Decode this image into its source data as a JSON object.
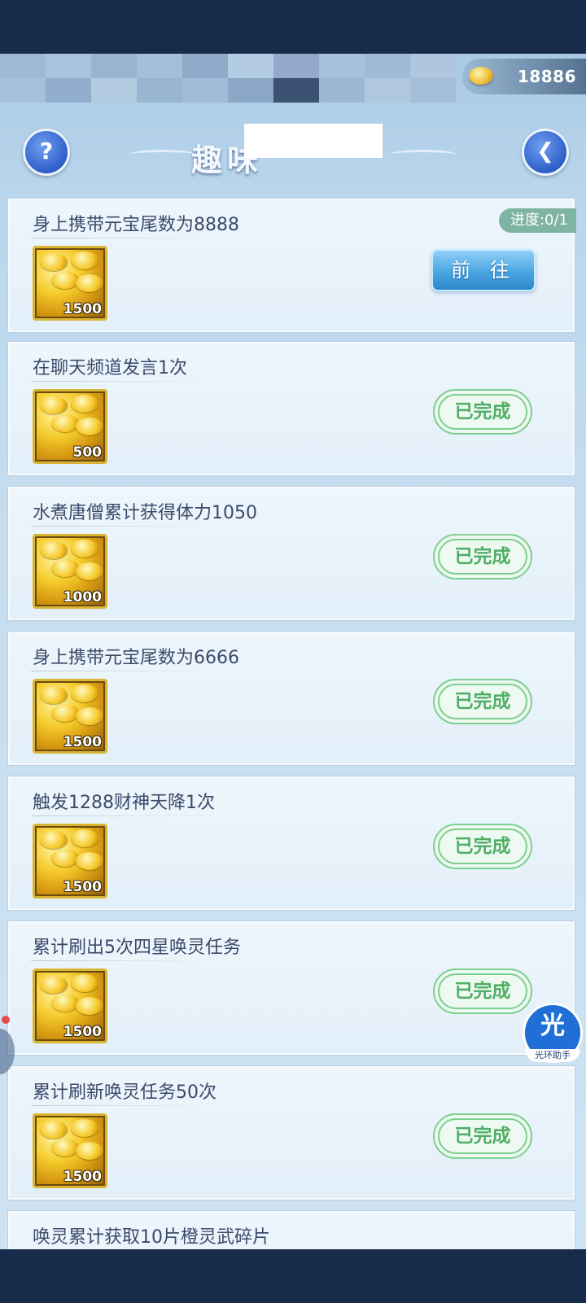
{
  "header": {
    "coin_value": "18886",
    "title": "趣味"
  },
  "tasks": [
    {
      "title": "身上携带元宝尾数为8888",
      "reward": "1500",
      "progress": "进度:0/1",
      "action": "前 往",
      "status": "go"
    },
    {
      "title": "在聊天频道发言1次",
      "reward": "500",
      "action": "已完成",
      "status": "done"
    },
    {
      "title": "水煮唐僧累计获得体力1050",
      "reward": "1000",
      "action": "已完成",
      "status": "done"
    },
    {
      "title": "身上携带元宝尾数为6666",
      "reward": "1500",
      "action": "已完成",
      "status": "done"
    },
    {
      "title": "触发1288财神天降1次",
      "reward": "1500",
      "action": "已完成",
      "status": "done"
    },
    {
      "title": "累计刷出5次四星唤灵任务",
      "reward": "1500",
      "action": "已完成",
      "status": "done"
    },
    {
      "title": "累计刷新唤灵任务50次",
      "reward": "1500",
      "action": "已完成",
      "status": "done"
    },
    {
      "title": "唤灵累计获取10片橙灵武碎片"
    }
  ],
  "assistant": {
    "icon_char": "光",
    "label": "光环助手"
  },
  "icons": {
    "help": "question-mark-icon",
    "back": "back-arrow-icon",
    "coin": "gold-ingot-icon"
  },
  "colors": {
    "accent_blue": "#4aa6e2",
    "done_green": "#4fae65",
    "progress_badge": "#7fb3a4"
  }
}
